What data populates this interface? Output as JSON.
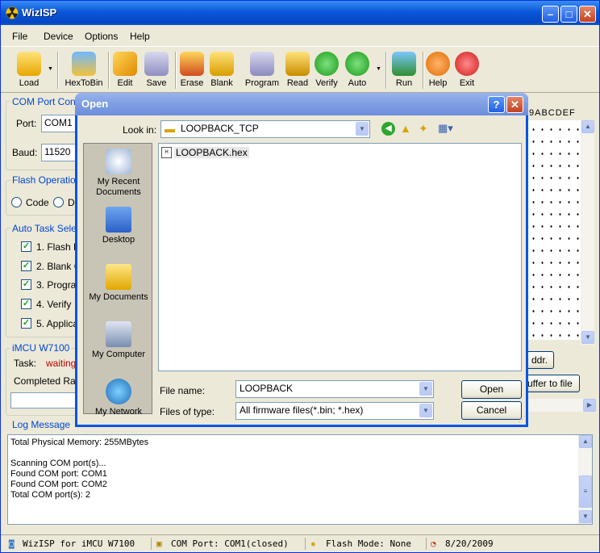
{
  "app": {
    "title": "WizISP"
  },
  "menu": [
    "File",
    "Device",
    "Options",
    "Help"
  ],
  "toolbar": {
    "load": "Load",
    "hextobin": "HexToBin",
    "edit": "Edit",
    "save": "Save",
    "erase": "Erase",
    "blank": "Blank",
    "program": "Program",
    "read": "Read",
    "verify": "Verify",
    "auto": "Auto",
    "run": "Run",
    "help": "Help",
    "exit": "Exit"
  },
  "com": {
    "group_label": "COM Port Config",
    "port_label": "Port:",
    "port_value": "COM1",
    "baud_label": "Baud:",
    "baud_value": "11520"
  },
  "flash_op": {
    "group_label": "Flash Operation",
    "code": "Code",
    "d": "D"
  },
  "auto_task": {
    "group_label": "Auto Task Selec",
    "items": [
      "1. Flash E",
      "2. Blank C",
      "3. Program",
      "4. Verify",
      "5. Applica"
    ]
  },
  "imcu": {
    "group_label": "iMCU W7100",
    "task_label": "Task:",
    "task_value": "waiting.",
    "completed_label": "Completed Rate"
  },
  "hex": {
    "header": "9ABCDEF",
    "addr_button": "ddr.",
    "buffer_button": "uffer to file"
  },
  "log": {
    "label": "Log Message",
    "lines": [
      "Total Physical Memory: 255MBytes",
      "",
      "Scanning COM port(s)...",
      "Found COM port: COM1",
      "Found COM port: COM2",
      "Total COM port(s): 2"
    ]
  },
  "status": {
    "app": "WizISP for iMCU W7100",
    "com": "COM Port: COM1(closed)",
    "flash": "Flash Mode: None",
    "date": "8/20/2009"
  },
  "dialog": {
    "title": "Open",
    "look_in_label": "Look in:",
    "look_in_value": "LOOPBACK_TCP",
    "places": [
      "My Recent Documents",
      "Desktop",
      "My Documents",
      "My Computer",
      "My Network"
    ],
    "files": [
      "LOOPBACK.hex"
    ],
    "file_name_label": "File name:",
    "file_name_value": "LOOPBACK",
    "file_type_label": "Files of type:",
    "file_type_value": "All firmware files(*.bin; *.hex)",
    "open_button": "Open",
    "cancel_button": "Cancel"
  },
  "colors": {
    "accent": "#0046d5",
    "task_value": "#c00000",
    "selection": "#316ac5"
  }
}
